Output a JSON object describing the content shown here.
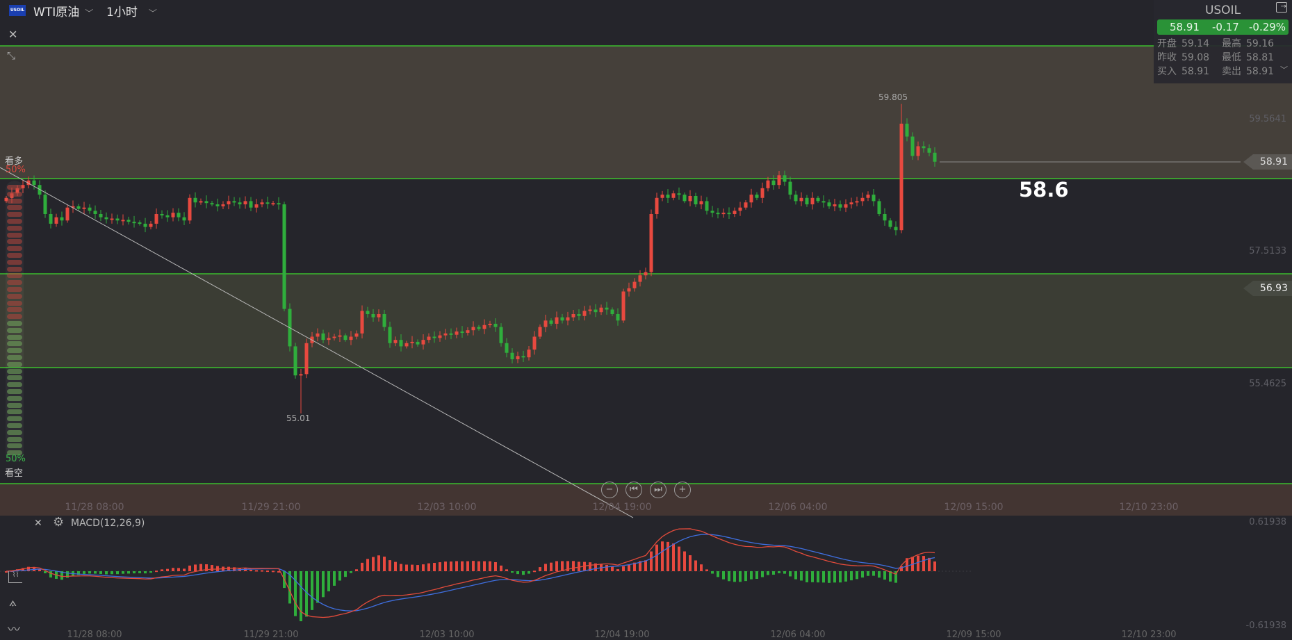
{
  "header": {
    "logo_text": "USOIL",
    "symbol": "WTI原油",
    "timeframe": "1小时"
  },
  "quote": {
    "symbol": "USOIL",
    "price": "58.91",
    "change": "-0.17",
    "change_pct": "-0.29%",
    "rows": [
      [
        "开盘",
        "59.14",
        "最高",
        "59.16"
      ],
      [
        "昨收",
        "59.08",
        "最低",
        "58.81"
      ],
      [
        "买入",
        "58.91",
        "卖出",
        "58.91"
      ]
    ]
  },
  "sentiment": {
    "bull_label": "看多",
    "bull_pct": "50%",
    "bear_label": "看空",
    "bear_pct": "50%",
    "bull_fraction": 0.5
  },
  "price_axis": {
    "labels": [
      "59.5641",
      "57.5133",
      "55.4625"
    ],
    "current_tag": "58.91",
    "level_tag": "56.93"
  },
  "annotations": {
    "high": "59.805",
    "low": "55.01",
    "level_text": "58.6"
  },
  "time_axis": [
    "11/28 08:00",
    "11/29 21:00",
    "12/03 10:00",
    "12/04 19:00",
    "12/06 04:00",
    "12/09 15:00",
    "12/10 23:00"
  ],
  "macd": {
    "title": "MACD(12,26,9)",
    "max_label": "0.61938",
    "min_label": "-0.61938"
  },
  "colors": {
    "up": "#e8493f",
    "down": "#2fae3c",
    "level_line": "#3fdc2c",
    "dif": "#e24b3b",
    "dea": "#3f6fe0"
  },
  "chart_data": {
    "type": "candlestick",
    "price_range": [
      55.4625,
      59.5641
    ],
    "levels": [
      60.7,
      58.65,
      57.17,
      55.72,
      54.0
    ],
    "current_price": 58.91,
    "high_extreme": {
      "bar": 161,
      "value": 59.805
    },
    "low_extreme": {
      "bar": 53,
      "value": 55.01
    },
    "closes": [
      58.35,
      58.42,
      58.5,
      58.55,
      58.62,
      58.55,
      58.4,
      58.1,
      57.95,
      58.05,
      58.0,
      58.2,
      58.22,
      58.18,
      58.2,
      58.15,
      58.1,
      58.05,
      58.02,
      58.03,
      58.0,
      58.01,
      57.98,
      57.97,
      57.95,
      57.9,
      57.95,
      58.1,
      58.08,
      58.05,
      58.12,
      58.05,
      58.0,
      58.35,
      58.28,
      58.3,
      58.27,
      58.25,
      58.22,
      58.25,
      58.3,
      58.28,
      58.25,
      58.3,
      58.2,
      58.25,
      58.28,
      58.26,
      58.27,
      58.25,
      56.63,
      56.05,
      55.6,
      55.62,
      56.1,
      56.2,
      56.25,
      56.15,
      56.18,
      56.2,
      56.22,
      56.15,
      56.2,
      56.25,
      56.6,
      56.55,
      56.5,
      56.55,
      56.35,
      56.1,
      56.15,
      56.05,
      56.1,
      56.12,
      56.08,
      56.15,
      56.2,
      56.18,
      56.22,
      56.25,
      56.23,
      56.28,
      56.26,
      56.3,
      56.35,
      56.32,
      56.38,
      56.4,
      56.35,
      56.1,
      55.95,
      55.85,
      55.9,
      55.88,
      56.0,
      56.2,
      56.35,
      56.45,
      56.4,
      56.5,
      56.45,
      56.5,
      56.55,
      56.52,
      56.6,
      56.62,
      56.58,
      56.65,
      56.62,
      56.55,
      56.45,
      56.9,
      56.95,
      57.05,
      57.15,
      57.2,
      58.1,
      58.35,
      58.4,
      58.35,
      58.42,
      58.4,
      58.3,
      58.38,
      58.25,
      58.3,
      58.15,
      58.12,
      58.1,
      58.12,
      58.1,
      58.15,
      58.2,
      58.28,
      58.4,
      58.35,
      58.5,
      58.62,
      58.55,
      58.7,
      58.6,
      58.4,
      58.3,
      58.35,
      58.25,
      58.35,
      58.3,
      58.28,
      58.22,
      58.25,
      58.2,
      58.25,
      58.28,
      58.3,
      58.35,
      58.4,
      58.3,
      58.1,
      58.0,
      57.9,
      57.85,
      59.5,
      59.3,
      59.0,
      59.15,
      59.12,
      59.05,
      58.91
    ]
  }
}
